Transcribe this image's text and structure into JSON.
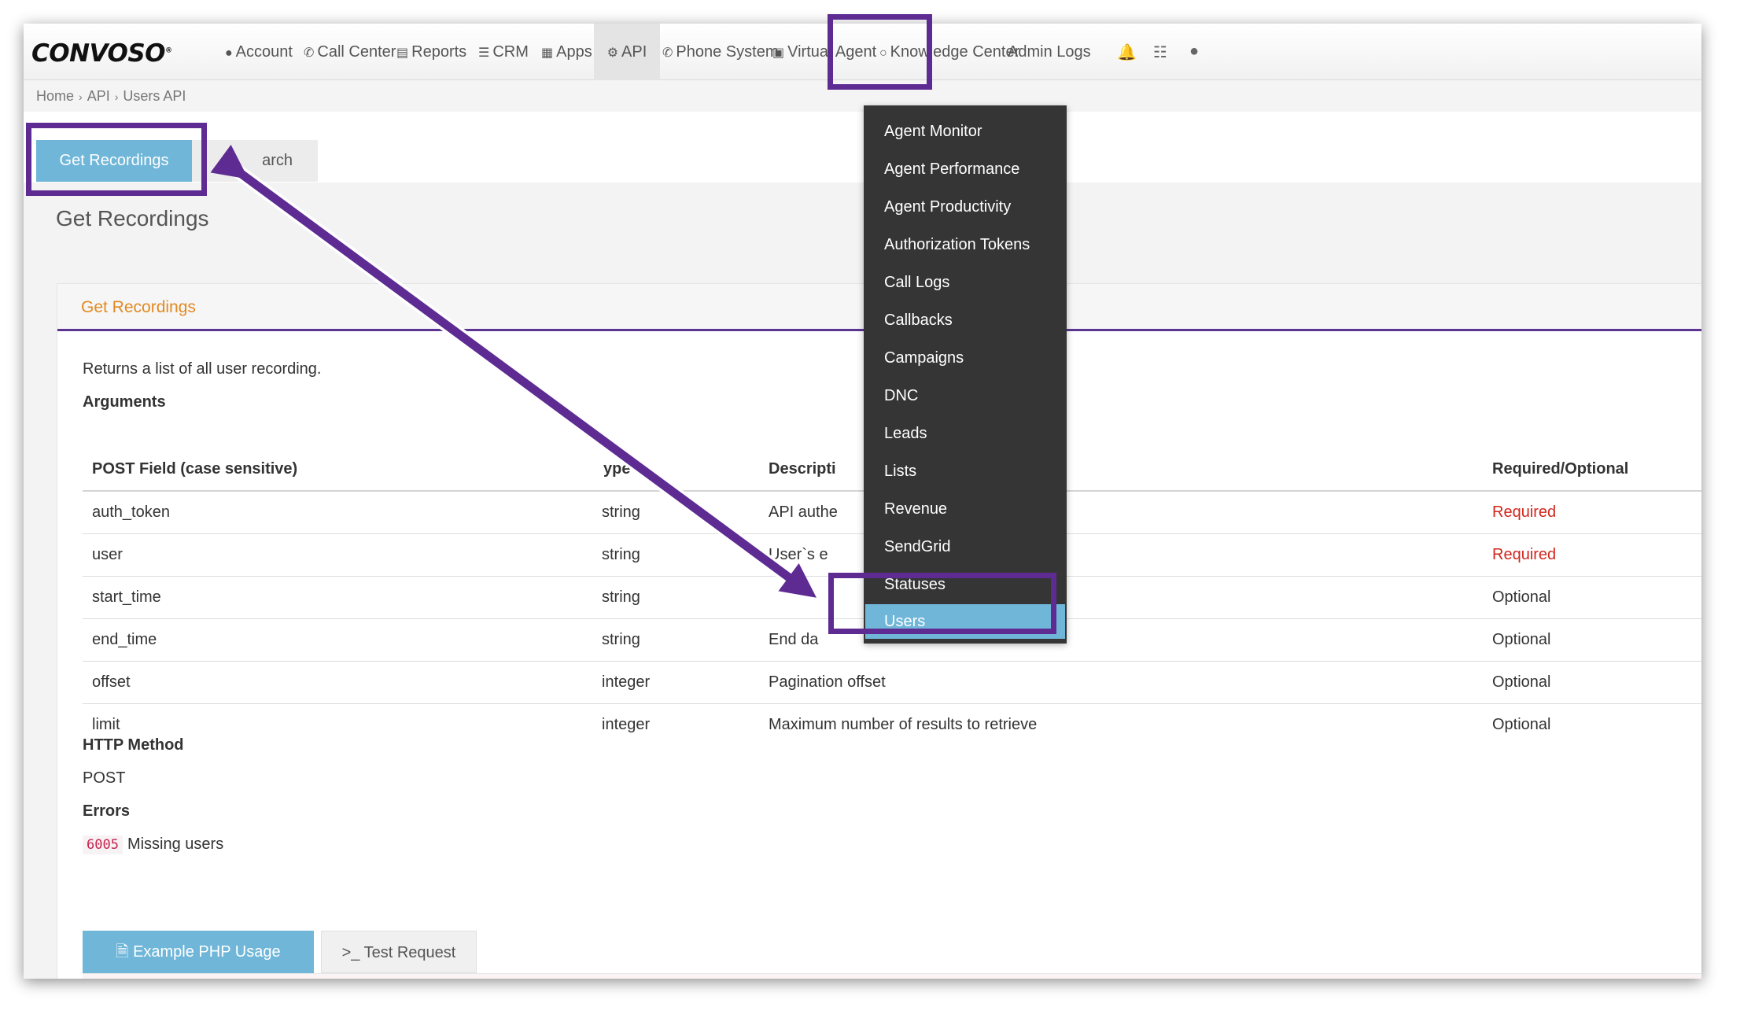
{
  "app": {
    "logo": "CONVOSO",
    "logo_mark": "®"
  },
  "nav": {
    "items": [
      {
        "label": "Account",
        "icon": "user-icon"
      },
      {
        "label": "Call Center",
        "icon": "phone-icon"
      },
      {
        "label": "Reports",
        "icon": "bar-chart-icon"
      },
      {
        "label": "CRM",
        "icon": "list-icon"
      },
      {
        "label": "Apps",
        "icon": "grid-icon"
      },
      {
        "label": "API",
        "icon": "gear-icon"
      },
      {
        "label": "Phone System",
        "icon": "phone-icon"
      },
      {
        "label": "Virtual Agent",
        "icon": "monitor-icon"
      },
      {
        "label": "Knowledge Center",
        "icon": "lightbulb-icon"
      },
      {
        "label": "Admin Logs",
        "icon": ""
      }
    ],
    "right_icons": [
      "bell-icon",
      "database-icon",
      "user-icon"
    ]
  },
  "breadcrumb": {
    "home": "Home",
    "api": "API",
    "current": "Users API"
  },
  "tabs": {
    "primary": "Get Recordings",
    "secondary_visible_text": "arch"
  },
  "page": {
    "title": "Get Recordings",
    "panel_title": "Get Recordings",
    "description": "Returns a list of all user recording.",
    "arguments_label": "Arguments",
    "http_method_label": "HTTP Method",
    "http_method_value": "POST",
    "errors_label": "Errors",
    "error_code": "6005",
    "error_text": "Missing users"
  },
  "table": {
    "headers": {
      "field": "POST Field (case sensitive)",
      "type": "ype",
      "description": "Descripti",
      "required": "Required/Optional"
    },
    "rows": [
      {
        "field": "auth_token",
        "type": "string",
        "description": "API authe",
        "required": "Required"
      },
      {
        "field": "user",
        "type": "string",
        "description": "User`s e",
        "required": "Required"
      },
      {
        "field": "start_time",
        "type": "string",
        "description": "",
        "required": "Optional"
      },
      {
        "field": "end_time",
        "type": "string",
        "description": "End da",
        "required": "Optional"
      },
      {
        "field": "offset",
        "type": "integer",
        "description": "Pagination offset",
        "required": "Optional"
      },
      {
        "field": "limit",
        "type": "integer",
        "description": "Maximum number of results to retrieve",
        "required": "Optional"
      }
    ]
  },
  "buttons": {
    "example": "Example PHP Usage",
    "test": ">_ Test Request"
  },
  "dropdown": {
    "items": [
      "Agent Monitor",
      "Agent Performance",
      "Agent Productivity",
      "Authorization Tokens",
      "Call Logs",
      "Callbacks",
      "Campaigns",
      "DNC",
      "Leads",
      "Lists",
      "Revenue",
      "SendGrid",
      "Statuses"
    ],
    "selected": "Users"
  },
  "colors": {
    "annotation": "#5e2b93",
    "accent_blue": "#6fb6d8",
    "panel_title": "#e28a21",
    "required_red": "#d0271d"
  }
}
